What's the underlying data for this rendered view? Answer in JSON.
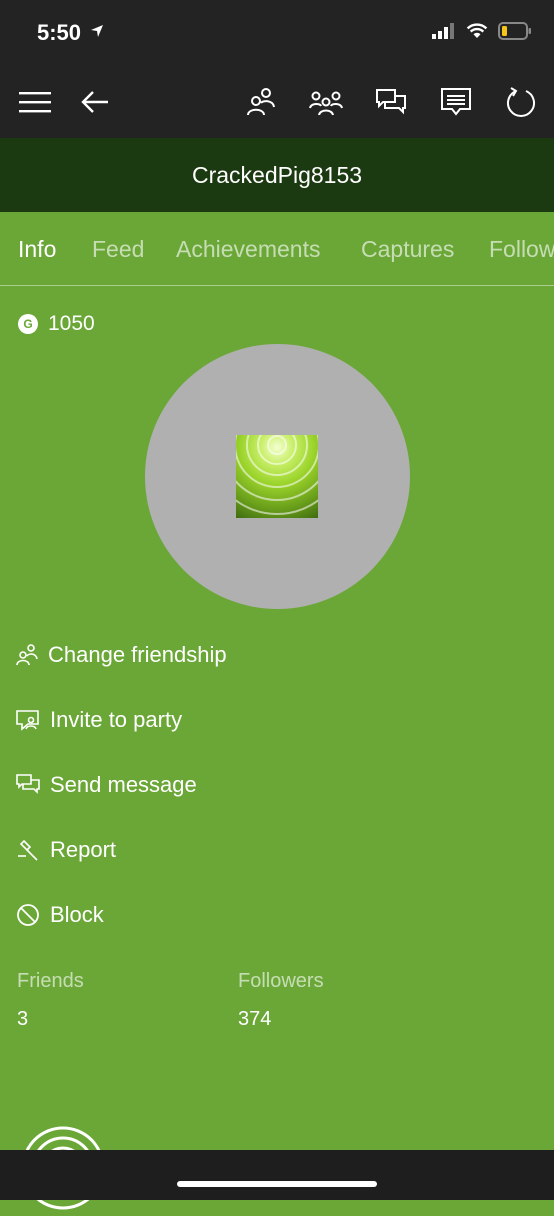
{
  "status": {
    "time": "5:50"
  },
  "profile": {
    "gamertag": "CrackedPig8153",
    "gamerscore_badge": "G",
    "gamerscore": "1050"
  },
  "tabs": [
    {
      "label": "Info"
    },
    {
      "label": "Feed"
    },
    {
      "label": "Achievements"
    },
    {
      "label": "Captures"
    },
    {
      "label": "Follow"
    }
  ],
  "actions": {
    "change_friendship": "Change friendship",
    "invite_to_party": "Invite to party",
    "send_message": "Send message",
    "report": "Report",
    "block": "Block"
  },
  "stats": {
    "friends_label": "Friends",
    "friends_value": "3",
    "followers_label": "Followers",
    "followers_value": "374"
  },
  "colors": {
    "background": "#6aa737",
    "title_bar": "#1c3a11",
    "app_bar": "#232323",
    "avatar_circle": "#b0b0b0"
  },
  "icons": {
    "app_bar": [
      "menu-icon",
      "back-icon",
      "friends-icon",
      "party-icon",
      "messages-icon",
      "activity-feed-icon",
      "refresh-icon"
    ]
  }
}
